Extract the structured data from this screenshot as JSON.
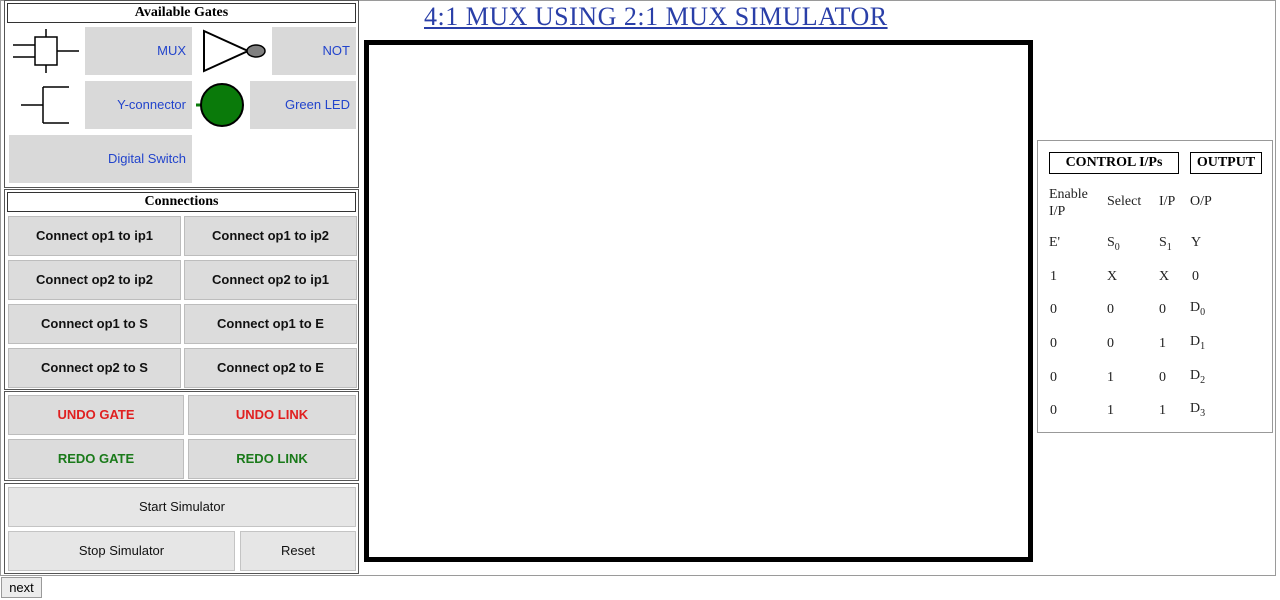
{
  "gates": {
    "title": "Available Gates",
    "items": [
      {
        "label": "MUX",
        "icon": "mux-icon"
      },
      {
        "label": "NOT",
        "icon": "not-gate-icon"
      },
      {
        "label": "Y-connector",
        "icon": "y-connector-icon"
      },
      {
        "label": "Green LED",
        "icon": "green-led-icon"
      },
      {
        "label": "Digital Switch",
        "icon": "digital-switch-icon"
      }
    ]
  },
  "connections": {
    "title": "Connections",
    "buttons": [
      "Connect op1 to ip1",
      "Connect op1 to ip2",
      "Connect op2 to ip2",
      "Connect op2 to ip1",
      "Connect op1 to S",
      "Connect op1 to E",
      "Connect op2 to S",
      "Connect op2 to E"
    ]
  },
  "history": {
    "undo_gate": "UNDO GATE",
    "undo_link": "UNDO LINK",
    "redo_gate": "REDO GATE",
    "redo_link": "REDO LINK"
  },
  "controls": {
    "start": "Start Simulator",
    "stop": "Stop Simulator",
    "reset": "Reset"
  },
  "page_title": "4:1 MUX USING 2:1 MUX SIMULATOR",
  "truth_table": {
    "control_header": "CONTROL I/Ps",
    "output_header": "OUTPUT",
    "col_labels": [
      "Enable I/P",
      "Select",
      "I/P",
      "O/P"
    ],
    "symbols": {
      "e": "E'",
      "s0": "S",
      "s0_sub": "0",
      "s1": "S",
      "s1_sub": "1",
      "y": "Y"
    },
    "rows": [
      [
        "1",
        "X",
        "X",
        "0",
        ""
      ],
      [
        "0",
        "0",
        "0",
        "D",
        "0"
      ],
      [
        "0",
        "0",
        "1",
        "D",
        "1"
      ],
      [
        "0",
        "1",
        "0",
        "D",
        "2"
      ],
      [
        "0",
        "1",
        "1",
        "D",
        "3"
      ]
    ]
  },
  "footer": {
    "next": "next"
  },
  "colors": {
    "accent": "#2a3fa8",
    "undo": "#e02020",
    "redo": "#1a7a1a",
    "led": "#0a7a0a"
  }
}
